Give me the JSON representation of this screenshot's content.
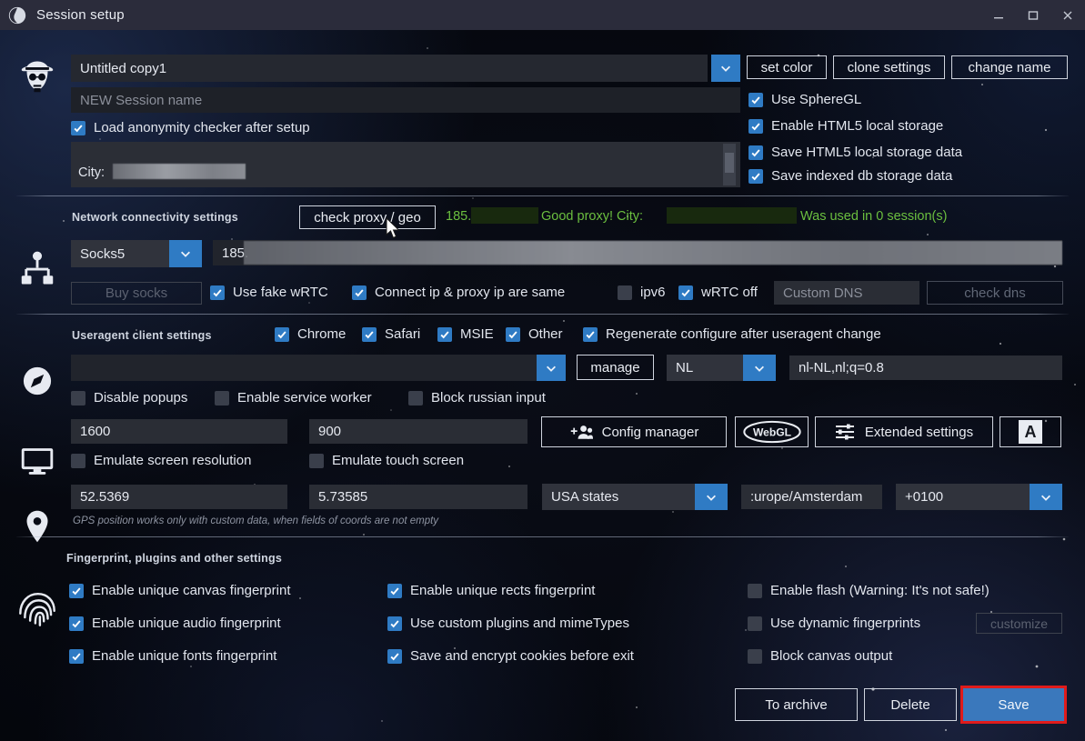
{
  "window": {
    "title": "Session setup",
    "logo_icon": "spider-logo-icon",
    "minimize_icon": "minimize-icon",
    "maximize_icon": "maximize-icon",
    "close_icon": "close-icon"
  },
  "rail": {
    "profile_icon": "heisenberg-avatar-icon",
    "network_icon": "network-nodes-icon",
    "browser_icon": "compass-icon",
    "screen_icon": "monitor-icon",
    "location_icon": "map-pin-icon",
    "fingerprint_icon": "fingerprint-icon"
  },
  "profile": {
    "session_name_value": "Untitled copy1",
    "session_name_dropdown_icon": "chevron-down-icon",
    "new_session_placeholder": "NEW Session name",
    "new_session_value": "",
    "set_color_label": "set color",
    "clone_settings_label": "clone settings",
    "change_name_label": "change name",
    "load_anonymity_label": "Load anonymity checker after setup",
    "load_anonymity_checked": true,
    "city_label": "City:",
    "city_value": "",
    "use_spheregl_label": "Use SphereGL",
    "use_spheregl_checked": true,
    "enable_html5_label": "Enable HTML5 local storage",
    "enable_html5_checked": true,
    "save_html5_label": "Save HTML5 local storage data",
    "save_html5_checked": true,
    "save_indexed_label": "Save indexed db storage data",
    "save_indexed_checked": true
  },
  "network": {
    "section_label": "Network connectivity settings",
    "check_proxy_label": "check proxy / geo",
    "proxy_ip_prefix": "185.",
    "proxy_status": "Good proxy! City:",
    "proxy_sessions": "Was used in 0 session(s)",
    "proxy_type_value": "Socks5",
    "proxy_type_dropdown_icon": "chevron-down-icon",
    "proxy_host_value": "185.",
    "buy_socks_label": "Buy socks",
    "use_fake_wrtc_label": "Use fake wRTC",
    "use_fake_wrtc_checked": true,
    "connect_ip_same_label": "Connect ip & proxy ip are same",
    "connect_ip_same_checked": true,
    "ipv6_label": "ipv6",
    "ipv6_checked": false,
    "wrtc_off_label": "wRTC off",
    "wrtc_off_checked": true,
    "custom_dns_placeholder": "Custom DNS",
    "custom_dns_value": "",
    "check_dns_label": "check dns"
  },
  "useragent": {
    "section_label": "Useragent client settings",
    "chrome_label": "Chrome",
    "chrome_checked": true,
    "safari_label": "Safari",
    "safari_checked": true,
    "msie_label": "MSIE",
    "msie_checked": true,
    "other_label": "Other",
    "other_checked": true,
    "regenerate_label": "Regenerate configure after useragent change",
    "regenerate_checked": true,
    "ua_value": "",
    "ua_dropdown_icon": "chevron-down-icon",
    "manage_label": "manage",
    "lang_value": "NL",
    "lang_dropdown_icon": "chevron-down-icon",
    "accept_lang_value": "nl-NL,nl;q=0.8",
    "disable_popups_label": "Disable popups",
    "disable_popups_checked": false,
    "enable_service_worker_label": "Enable service worker",
    "enable_service_worker_checked": false,
    "block_russian_input_label": "Block russian input",
    "block_russian_input_checked": false
  },
  "screen": {
    "width_value": "1600",
    "height_value": "900",
    "emulate_resolution_label": "Emulate screen resolution",
    "emulate_resolution_checked": false,
    "emulate_touch_label": "Emulate touch screen",
    "emulate_touch_checked": false,
    "config_manager_label": "Config manager",
    "config_manager_icon": "add-users-icon",
    "webgl_label": "WebGL",
    "webgl_icon": "webgl-logo-icon",
    "extended_settings_label": "Extended settings",
    "extended_settings_icon": "sliders-icon",
    "font_button_label": "A",
    "font_button_icon": "font-letter-icon"
  },
  "geo": {
    "latitude_value": "52.5369",
    "longitude_value": "5.73585",
    "states_value": "USA states",
    "states_dropdown_icon": "chevron-down-icon",
    "timezone_value": ":urope/Amsterdam",
    "offset_value": "+0100",
    "offset_dropdown_icon": "chevron-down-icon",
    "gps_note": "GPS position works only with custom data, when fields of coords are not empty"
  },
  "fingerprint": {
    "section_label": "Fingerprint, plugins and other settings",
    "canvas_label": "Enable unique canvas fingerprint",
    "canvas_checked": true,
    "audio_label": "Enable unique audio fingerprint",
    "audio_checked": true,
    "fonts_label": "Enable unique fonts fingerprint",
    "fonts_checked": true,
    "rects_label": "Enable unique rects fingerprint",
    "rects_checked": true,
    "plugins_label": "Use custom plugins and mimeTypes",
    "plugins_checked": true,
    "cookies_label": "Save and encrypt cookies before exit",
    "cookies_checked": true,
    "flash_label": "Enable flash (Warning: It's not safe!)",
    "flash_checked": false,
    "dynamic_label": "Use dynamic fingerprints",
    "dynamic_checked": false,
    "customize_label": "customize",
    "block_canvas_label": "Block canvas output",
    "block_canvas_checked": false
  },
  "footer": {
    "to_archive_label": "To archive",
    "delete_label": "Delete",
    "save_label": "Save"
  },
  "colors": {
    "accent_blue": "#2f7bc4",
    "save_blue": "#3a78bc",
    "highlight_red": "#e01b1b",
    "proxy_green": "#6bbf3f",
    "titlebar": "#2b2c3b"
  }
}
